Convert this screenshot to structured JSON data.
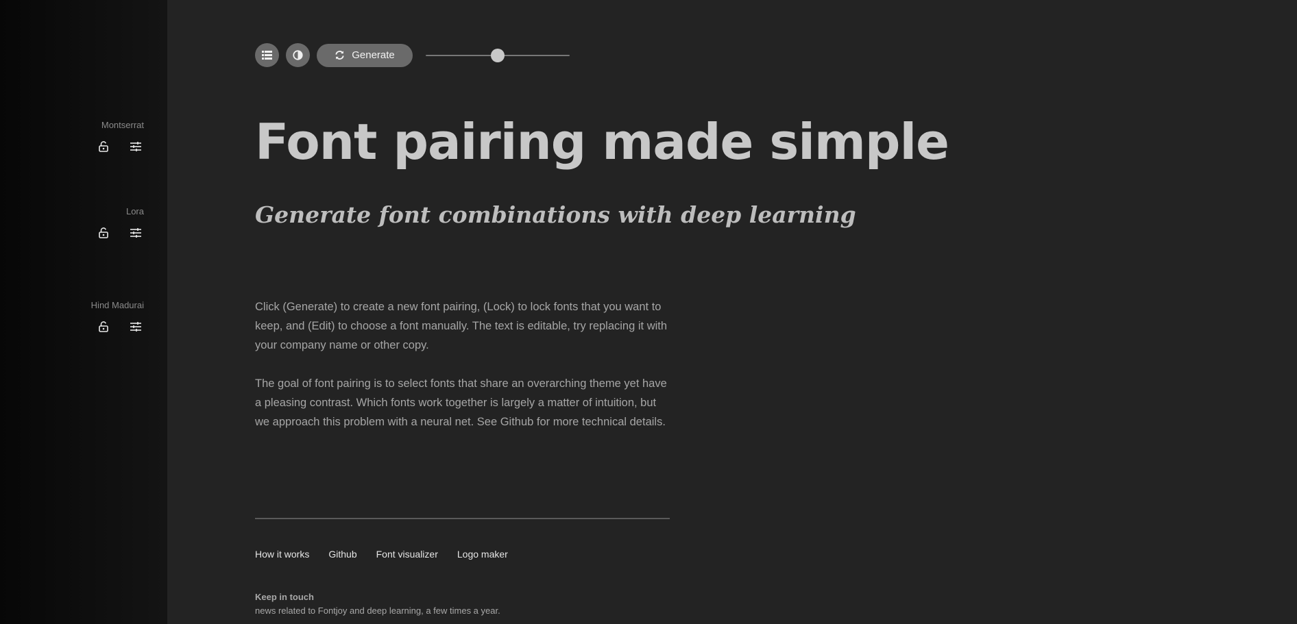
{
  "sidebar": {
    "fonts": [
      {
        "name": "Montserrat",
        "lock_icon": "lock-open-icon",
        "edit_icon": "sliders-icon"
      },
      {
        "name": "Lora",
        "lock_icon": "lock-open-icon",
        "edit_icon": "sliders-icon"
      },
      {
        "name": "Hind Madurai",
        "lock_icon": "lock-open-icon",
        "edit_icon": "sliders-icon"
      }
    ]
  },
  "toolbar": {
    "list_icon": "list-icon",
    "contrast_icon": "contrast-icon",
    "generate_icon": "refresh-icon",
    "generate_label": "Generate",
    "slider_value": 0.5
  },
  "main": {
    "headline": "Font pairing made simple",
    "subheadline": "Generate font combinations with deep learning",
    "paragraphs": [
      "Click (Generate) to create a new font pairing, (Lock) to lock fonts that you want to keep, and (Edit) to choose a font manually. The text is editable, try replacing it with your company name or other copy.",
      "The goal of font pairing is to select fonts that share an overarching theme yet have a pleasing contrast. Which fonts work together is largely a matter of intuition, but we approach this problem with a neural net. See Github for more technical details."
    ]
  },
  "footer": {
    "links": [
      "How it works",
      "Github",
      "Font visualizer",
      "Logo maker"
    ],
    "keep_in_touch_title": "Keep in touch",
    "keep_in_touch_desc": "news related to Fontjoy and deep learning, a few times a year."
  },
  "colors": {
    "background": "#232323",
    "sidebar": "#0d0d0d",
    "button": "#6a6a6a",
    "headline": "#c8c8c8"
  }
}
